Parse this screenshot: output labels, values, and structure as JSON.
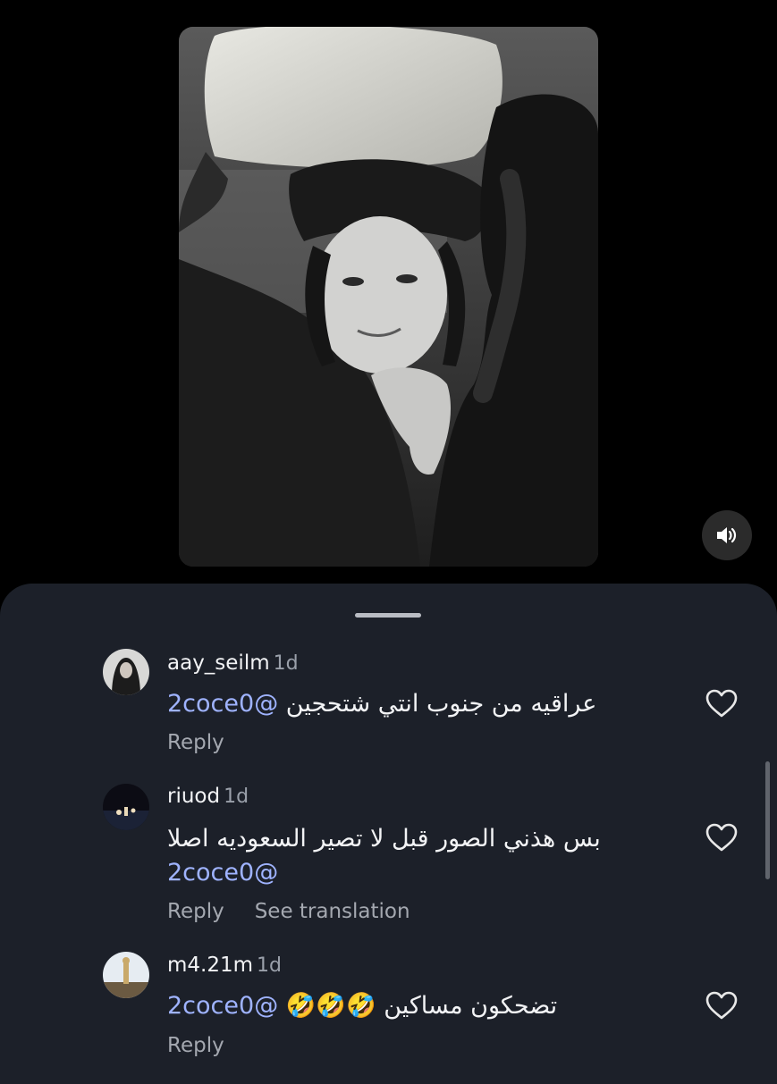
{
  "comments": [
    {
      "username": "aay_seilm",
      "time": "1d",
      "mention": "@2coce0",
      "text": "عراقيه من جنوب انتي شتحجين",
      "reply_label": "Reply"
    },
    {
      "username": "riuod",
      "time": "1d",
      "mention": "@2coce0",
      "text": "بس هذني الصور قبل لا تصير السعوديه اصلا",
      "reply_label": "Reply",
      "translate_label": "See translation"
    },
    {
      "username": "m4.21m",
      "time": "1d",
      "mention": "@2coce0",
      "text": "تضحكون مساكين 🤣🤣🤣",
      "reply_label": "Reply"
    }
  ],
  "icons": {
    "sound": "speaker-icon",
    "like": "heart-outline-icon"
  },
  "colors": {
    "sheet_background": "#1c2029",
    "mention": "#9fb3ff",
    "secondary_text": "#a4a8b0"
  }
}
